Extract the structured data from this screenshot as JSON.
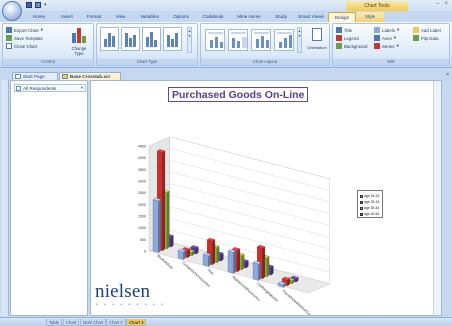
{
  "titlebar": {
    "context_tools": "Chart Tools",
    "minimize": "–",
    "close": "×",
    "icons": [
      "save-icon",
      "undo-icon",
      "dropdown-icon"
    ]
  },
  "ribbon_tabs": [
    {
      "label": "Home"
    },
    {
      "label": "Insert"
    },
    {
      "label": "Format"
    },
    {
      "label": "View"
    },
    {
      "label": "Variables"
    },
    {
      "label": "Options"
    },
    {
      "label": "Codebook"
    },
    {
      "label": "Mine Home"
    },
    {
      "label": "Study"
    },
    {
      "label": "Smart Views"
    },
    {
      "label": "Design"
    },
    {
      "label": "Style"
    }
  ],
  "control_group": {
    "label": "Control",
    "export_chart": "Export Chart",
    "save_template": "Save Template",
    "close_chart": "Close Chart",
    "change_type": "Change Type"
  },
  "chart_type_group": {
    "label": "Chart Type"
  },
  "chart_layout_group": {
    "label": "Chart Layout",
    "orientation": "Orientation"
  },
  "edit_group": {
    "label": "Edit",
    "title": "Title",
    "legend": "Legend",
    "background": "Background",
    "labels": "Labels",
    "axes": "Axes",
    "series": "Series",
    "add_label": "Add Label",
    "flip_data": "Flip Data"
  },
  "doc_tabs": [
    {
      "label": "Start Page"
    },
    {
      "label": "Base Crosstab.xcr"
    }
  ],
  "filter": {
    "value": "All Respondents"
  },
  "chart_data": {
    "type": "bar",
    "title": "Purchased Goods On-Line",
    "categories": [
      "Books/Music",
      "Computer/Accessories",
      "Toys",
      "Appliances/Electronics",
      "Clothing/Apparel",
      "Travel/Hotel/Airline/Car"
    ],
    "series": [
      {
        "name": "age 18-24",
        "color": "#8ea7dd",
        "values": [
          2200,
          320,
          450,
          900,
          700,
          120
        ]
      },
      {
        "name": "age 25-34",
        "color": "#c8302d",
        "values": [
          4200,
          300,
          1000,
          900,
          1300,
          230
        ]
      },
      {
        "name": "age 35-44",
        "color": "#8cbb3f",
        "values": [
          2400,
          150,
          650,
          600,
          800,
          130
        ]
      },
      {
        "name": "age 45-54",
        "color": "#5d3e98",
        "values": [
          420,
          230,
          270,
          250,
          320,
          120
        ]
      }
    ],
    "yticks": [
      "0",
      "500",
      "1000",
      "1500",
      "2000",
      "2500",
      "3000",
      "3500",
      "4000",
      "4500"
    ],
    "ylim": [
      0,
      4500
    ],
    "grid": true,
    "legend_position": "right",
    "view": "3d-perspective"
  },
  "brand": {
    "name": "nielsen",
    "dots": "• • • • • • • • •"
  },
  "sheets": [
    {
      "label": "Table"
    },
    {
      "label": "Chart"
    },
    {
      "label": "Multi Chart"
    },
    {
      "label": "Chart 2"
    },
    {
      "label": "Chart 3"
    }
  ]
}
